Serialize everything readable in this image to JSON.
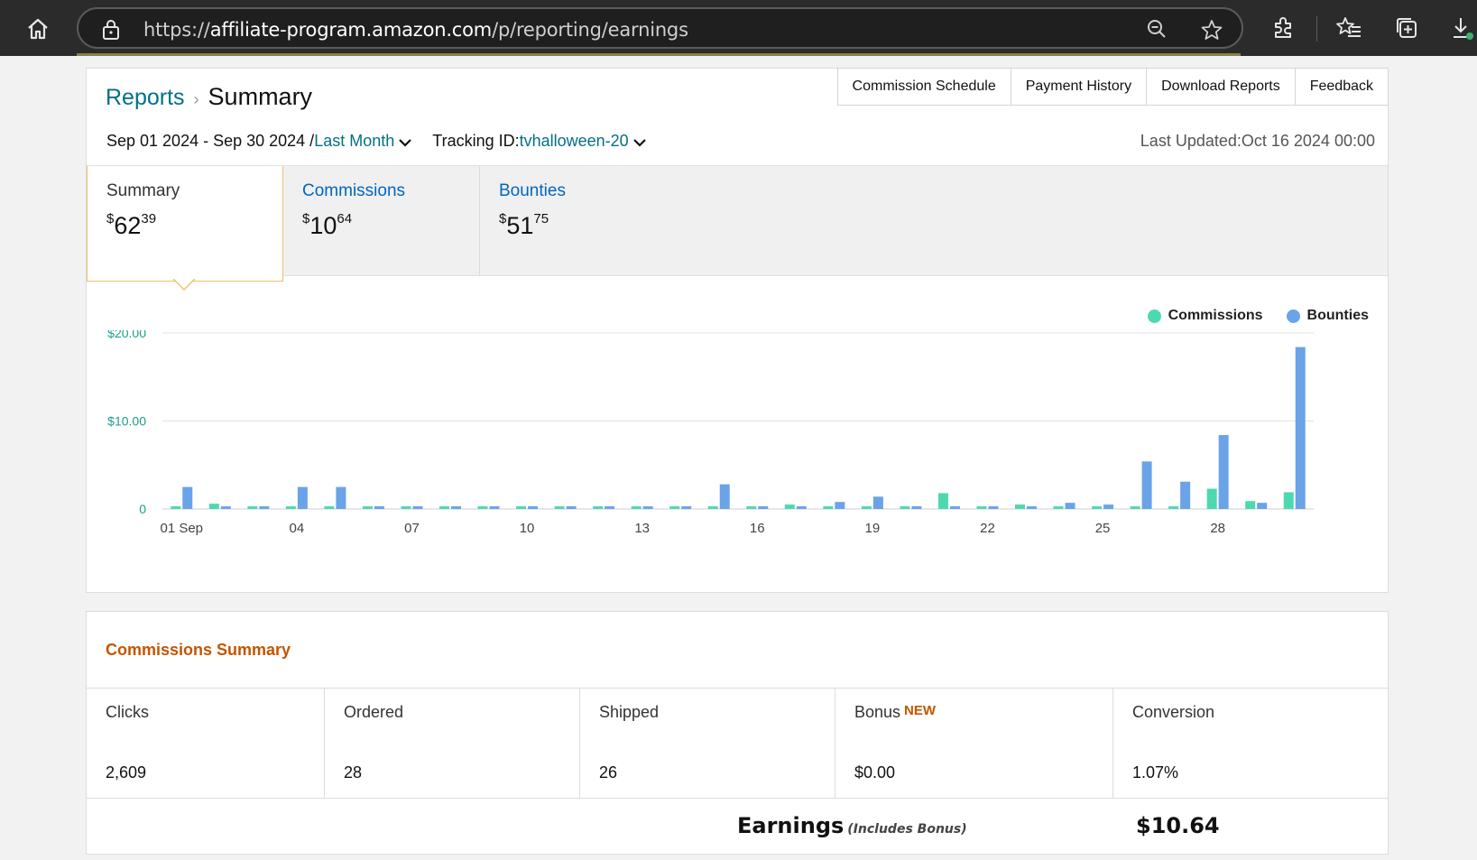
{
  "browser": {
    "url_prefix": "https://",
    "url_domain": "affiliate-program.amazon.com",
    "url_path": "/p/reporting/earnings"
  },
  "header": {
    "breadcrumb_root": "Reports",
    "title": "Summary",
    "nav": [
      "Commission Schedule",
      "Payment History",
      "Download Reports",
      "Feedback"
    ]
  },
  "filters": {
    "date_range": "Sep 01 2024 - Sep 30 2024 /",
    "period": "Last Month",
    "tracking_label": "Tracking ID:",
    "tracking_id": "tvhalloween-20",
    "last_updated": "Last Updated:Oct 16 2024 00:00"
  },
  "tabs": [
    {
      "label": "Summary",
      "dollars": "62",
      "cents": "39"
    },
    {
      "label": "Commissions",
      "dollars": "10",
      "cents": "64"
    },
    {
      "label": "Bounties",
      "dollars": "51",
      "cents": "75"
    }
  ],
  "colors": {
    "commissions": "#4dd9b0",
    "bounties": "#6aa3e8",
    "link": "#007185",
    "accent_orange": "#c45500"
  },
  "chart_data": {
    "type": "bar",
    "legend": [
      "Commissions",
      "Bounties"
    ],
    "legend_position": "top-right",
    "categories": [
      "01 Sep",
      "02",
      "03",
      "04",
      "05",
      "06",
      "07",
      "08",
      "09",
      "10",
      "11",
      "12",
      "13",
      "14",
      "15",
      "16",
      "17",
      "18",
      "19",
      "20",
      "21",
      "22",
      "23",
      "24",
      "25",
      "26",
      "27",
      "28",
      "29",
      "30"
    ],
    "x_tick_labels": [
      "01 Sep",
      "04",
      "07",
      "10",
      "13",
      "16",
      "19",
      "22",
      "25",
      "28"
    ],
    "y_tick_labels": [
      "0",
      "$10.00",
      "$20.00"
    ],
    "ylim": [
      0,
      20
    ],
    "grid": true,
    "series": [
      {
        "name": "Commissions",
        "values": [
          0.3,
          0.6,
          0.3,
          0.3,
          0.3,
          0.3,
          0.3,
          0.3,
          0.3,
          0.3,
          0.3,
          0.3,
          0.3,
          0.3,
          0.3,
          0.3,
          0.5,
          0.3,
          0.3,
          0.3,
          1.8,
          0.3,
          0.5,
          0.3,
          0.3,
          0.3,
          0.3,
          2.3,
          0.9,
          1.9
        ]
      },
      {
        "name": "Bounties",
        "values": [
          2.5,
          0.3,
          0.3,
          2.5,
          2.5,
          0.3,
          0.3,
          0.3,
          0.3,
          0.3,
          0.3,
          0.3,
          0.3,
          0.3,
          2.8,
          0.3,
          0.3,
          0.8,
          1.4,
          0.3,
          0.3,
          0.3,
          0.3,
          0.7,
          0.5,
          5.4,
          3.1,
          8.4,
          0.7,
          18.4
        ]
      }
    ]
  },
  "commissions_summary": {
    "title": "Commissions Summary",
    "metrics": [
      {
        "label": "Clicks",
        "value": "2,609"
      },
      {
        "label": "Ordered",
        "value": "28"
      },
      {
        "label": "Shipped",
        "value": "26"
      },
      {
        "label": "Bonus",
        "badge": "NEW",
        "value": "$0.00"
      },
      {
        "label": "Conversion",
        "value": "1.07%"
      }
    ],
    "earnings_label": "Earnings",
    "earnings_note": "(Includes Bonus)",
    "earnings_value": "$10.64"
  }
}
